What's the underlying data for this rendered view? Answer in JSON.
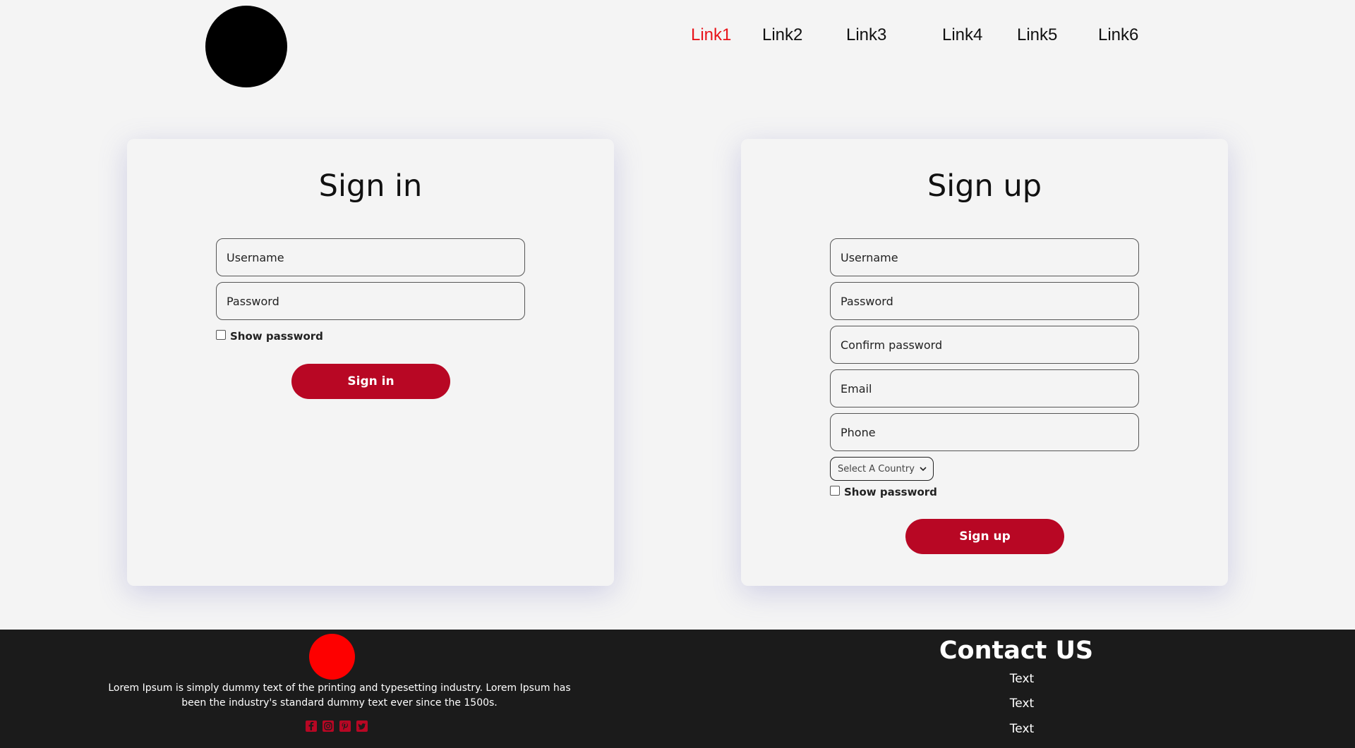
{
  "header": {
    "nav": [
      "Link1",
      "Link2",
      "Link3",
      "Link4",
      "Link5",
      "Link6"
    ],
    "active_link": "Link1",
    "active_color": "#e8141a"
  },
  "signin": {
    "title": "Sign in",
    "username_placeholder": "Username",
    "password_placeholder": "Password",
    "show_password_label": "Show password",
    "button_label": "Sign in"
  },
  "signup": {
    "title": "Sign up",
    "username_placeholder": "Username",
    "password_placeholder": "Password",
    "confirm_password_placeholder": "Confirm password",
    "email_placeholder": "Email",
    "phone_placeholder": "Phone",
    "country_select_value": "Select A Country",
    "show_password_label": "Show password",
    "button_label": "Sign up"
  },
  "footer": {
    "description": "Lorem Ipsum is simply dummy text of the printing and typesetting industry. Lorem Ipsum has been the industry's standard dummy text ever since the 1500s.",
    "socials": [
      "facebook-icon",
      "instagram-icon",
      "pinterest-icon",
      "twitter-icon"
    ],
    "contact_title": "Contact US",
    "contact_items": [
      "Text",
      "Text",
      "Text"
    ]
  },
  "colors": {
    "accent": "#b80724",
    "footer_bg": "#1b1b1b",
    "footer_logo": "#fe0000"
  }
}
